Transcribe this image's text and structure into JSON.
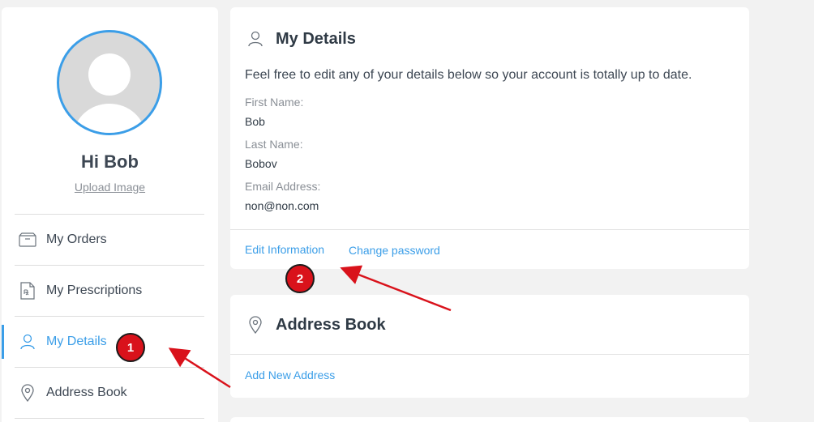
{
  "sidebar": {
    "greeting": "Hi Bob",
    "upload_label": "Upload Image",
    "items": [
      {
        "label": "My Orders",
        "icon": "box-icon"
      },
      {
        "label": "My Prescriptions",
        "icon": "prescription-icon"
      },
      {
        "label": "My Details",
        "icon": "user-icon",
        "active": true
      },
      {
        "label": "Address Book",
        "icon": "location-pin-icon"
      }
    ]
  },
  "details": {
    "title": "My Details",
    "intro": "Feel free to edit any of your details below so your account is totally up to date.",
    "fields": [
      {
        "label": "First Name:",
        "value": "Bob"
      },
      {
        "label": "Last Name:",
        "value": "Bobov"
      },
      {
        "label": "Email Address:",
        "value": "non@non.com"
      }
    ],
    "edit_label": "Edit Information",
    "password_label": "Change password"
  },
  "address": {
    "title": "Address Book",
    "add_label": "Add New Address"
  },
  "annotations": {
    "badge1": "1",
    "badge2": "2"
  },
  "colors": {
    "accent": "#3b9ee8",
    "annotation": "#d9121b"
  }
}
